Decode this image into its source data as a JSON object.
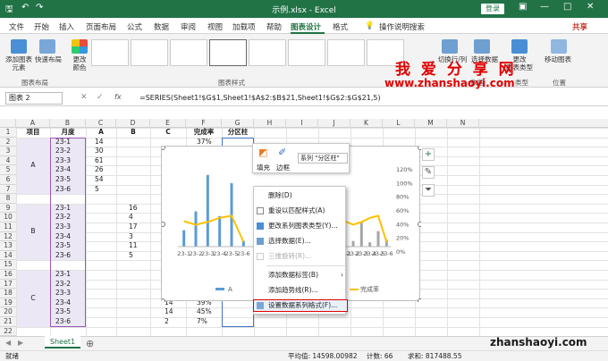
{
  "app": {
    "title": "示例.xlsx - Excel",
    "login": "登录"
  },
  "tabs": [
    "文件",
    "开始",
    "插入",
    "页面布局",
    "公式",
    "数据",
    "审阅",
    "视图",
    "加载项",
    "帮助",
    "图表设计",
    "格式"
  ],
  "active_tab": "图表设计",
  "search": "操作说明搜索",
  "share": "共享",
  "ribbon": {
    "add_element": "添加图表\n元素",
    "quick_layout": "快速布局",
    "change_colors": "更改\n颜色",
    "switch_rowcol": "切换行/列",
    "select_data": "选择数据",
    "change_type": "更改\n图表类型",
    "move_chart": "移动图表",
    "groups": {
      "layouts": "图表布局",
      "styles": "图表样式",
      "data": "数据",
      "type": "类型",
      "location": "位置"
    }
  },
  "watermark": {
    "text": "我 爱 分 享 网",
    "url": "www.zhanshaoyi.com",
    "url2": "zhanshaoyi.com"
  },
  "namebox": "图表 2",
  "formula": "=SERIES(Sheet1!$G$1,Sheet1!$A$2:$B$21,Sheet1!$G$2:$G$21,5)",
  "columns": [
    "A",
    "B",
    "C",
    "D",
    "E",
    "F",
    "G",
    "H",
    "I",
    "J",
    "K",
    "L",
    "M",
    "N"
  ],
  "headers": {
    "a": "项目",
    "b": "月度",
    "c": "A",
    "d": "B",
    "e": "C",
    "f": "完成率",
    "g": "分区柱"
  },
  "group_labels": [
    "A",
    "B",
    "C"
  ],
  "months": [
    "23-1",
    "23-2",
    "23-3",
    "23-4",
    "23-5",
    "23-6"
  ],
  "colC": [
    "14",
    "30",
    "61",
    "26",
    "54",
    "5"
  ],
  "colD": [
    "16",
    "4",
    "17",
    "3",
    "11",
    "5"
  ],
  "colE": [
    "14",
    "14",
    "2"
  ],
  "colF": [
    "37%",
    "32%",
    "39%",
    "45%",
    "7%"
  ],
  "row_numbers": [
    "1",
    "2",
    "3",
    "4",
    "5",
    "6",
    "7",
    "8",
    "9",
    "10",
    "11",
    "12",
    "13",
    "14",
    "15",
    "16",
    "17",
    "18",
    "19",
    "20",
    "21",
    "22"
  ],
  "minibar": {
    "fill": "填充",
    "border": "边框",
    "series": "系列 \"分区柱\""
  },
  "context_menu": [
    "删除(D)",
    "重设以匹配样式(A)",
    "更改系列图表类型(Y)...",
    "选择数据(E)...",
    "三维旋转(R)...",
    "添加数据标签(B)",
    "添加趋势线(R)...",
    "设置数据系列格式(F)..."
  ],
  "chart_data": {
    "type": "bar",
    "left_categories": [
      "23-1",
      "23-2",
      "23-3",
      "23-4",
      "23-5",
      "23-6"
    ],
    "right_categories": [
      "23-1",
      "23-2",
      "23-3",
      "23-4",
      "23-5",
      "23-6"
    ],
    "y2_ticks": [
      "120%",
      "100%",
      "80%",
      "60%",
      "40%",
      "20%",
      "0%"
    ],
    "legend": [
      "A",
      "完成率"
    ],
    "series_A": [
      14,
      30,
      61,
      26,
      54,
      5
    ],
    "series_B": [
      16,
      4,
      17,
      3,
      11,
      5
    ],
    "completion": [
      0.37,
      0.32,
      0.36,
      0.42,
      0.45,
      0.07
    ],
    "colors": {
      "A": "#5b9bd5",
      "B": "#a5a5a5",
      "line": "#ffc000"
    }
  },
  "sheet_tab": "Sheet1",
  "status": {
    "ready": "就绪",
    "avg": "平均值: 14598.00982",
    "count": "计数: 66",
    "sum": "求和: 817488.55"
  }
}
